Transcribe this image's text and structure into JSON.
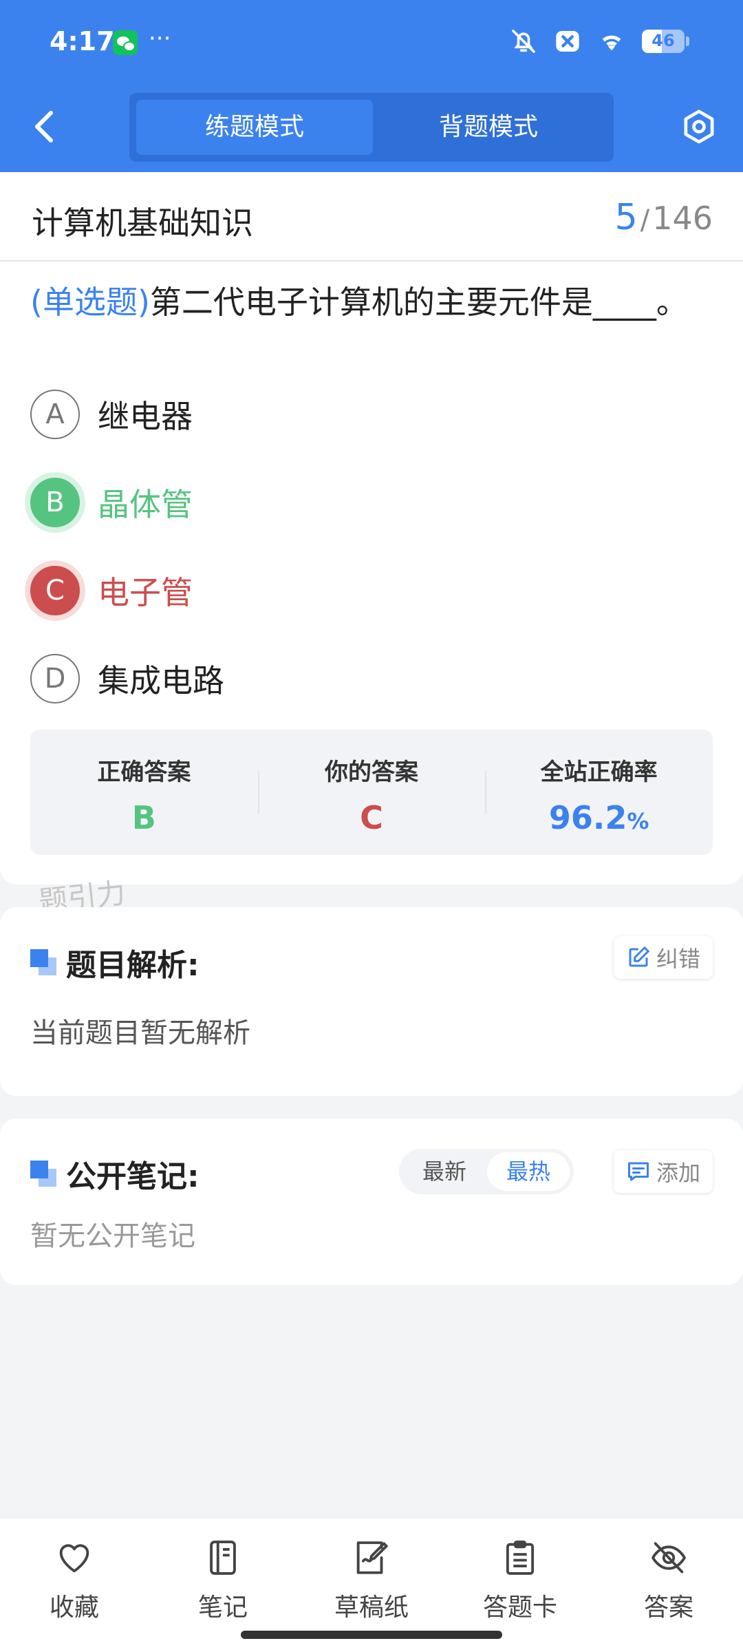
{
  "status_bar": {
    "time": "4:17",
    "battery_level": 46,
    "battery_text": "46",
    "more": "···"
  },
  "header": {
    "mode_tabs": [
      "练题模式",
      "背题模式"
    ],
    "active_mode": "练题模式",
    "accent_color": "#3b82ef"
  },
  "question_card": {
    "subject": "计算机基础知识",
    "current": "5",
    "separator": "/",
    "total": "146",
    "type_label": "(单选题)",
    "question_text": "第二代电子计算机的主要元件是____。",
    "options": [
      {
        "letter": "A",
        "text": "继电器",
        "state": "normal"
      },
      {
        "letter": "B",
        "text": "晶体管",
        "state": "correct"
      },
      {
        "letter": "C",
        "text": "电子管",
        "state": "wrong"
      },
      {
        "letter": "D",
        "text": "集成电路",
        "state": "normal"
      }
    ],
    "stats": {
      "correct_label": "正确答案",
      "correct_value": "B",
      "yours_label": "你的答案",
      "yours_value": "C",
      "rate_label": "全站正确率",
      "rate_value": "96.2",
      "rate_unit": "%"
    },
    "colors": {
      "correct": "#56c481",
      "wrong": "#cc4d4d"
    }
  },
  "watermark": "题引力",
  "analysis": {
    "title": "题目解析:",
    "button": "纠错",
    "body": "当前题目暂无解析"
  },
  "notes": {
    "title": "公开笔记:",
    "sort_options": [
      "最新",
      "最热"
    ],
    "active_sort": "最热",
    "button": "添加",
    "body": "暂无公开笔记"
  },
  "bottom_nav": [
    {
      "label": "收藏",
      "icon": "heart-icon"
    },
    {
      "label": "笔记",
      "icon": "notebook-icon"
    },
    {
      "label": "草稿纸",
      "icon": "draft-paper-icon"
    },
    {
      "label": "答题卡",
      "icon": "answer-card-icon"
    },
    {
      "label": "答案",
      "icon": "eye-off-icon"
    }
  ]
}
